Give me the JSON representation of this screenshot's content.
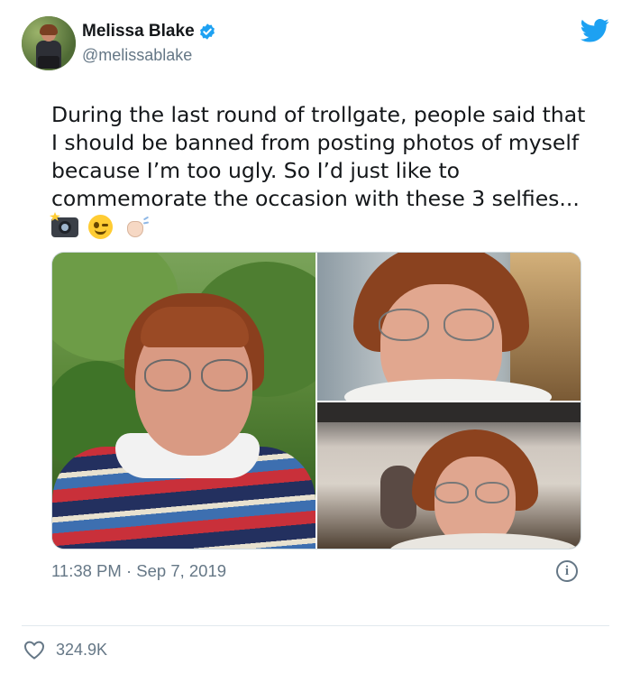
{
  "author": {
    "name": "Melissa Blake",
    "handle": "@melissablake"
  },
  "tweet": {
    "text": "During the last round of trollgate, people said that I should be banned from posting photos of myself because I’m too ugly. So I’d just like to commemorate the occasion with these 3 selfies...",
    "emojis": [
      "camera-with-flash",
      "winking-face",
      "waving-hand"
    ]
  },
  "meta": {
    "time": "11:38 PM",
    "separator": "·",
    "date": "Sep 7, 2019",
    "info_label": "i"
  },
  "stats": {
    "likes": "324.9K"
  },
  "colors": {
    "twitter_blue": "#1da1f2",
    "text_primary": "#14171a",
    "text_secondary": "#657786",
    "divider": "#e1e8ed"
  }
}
